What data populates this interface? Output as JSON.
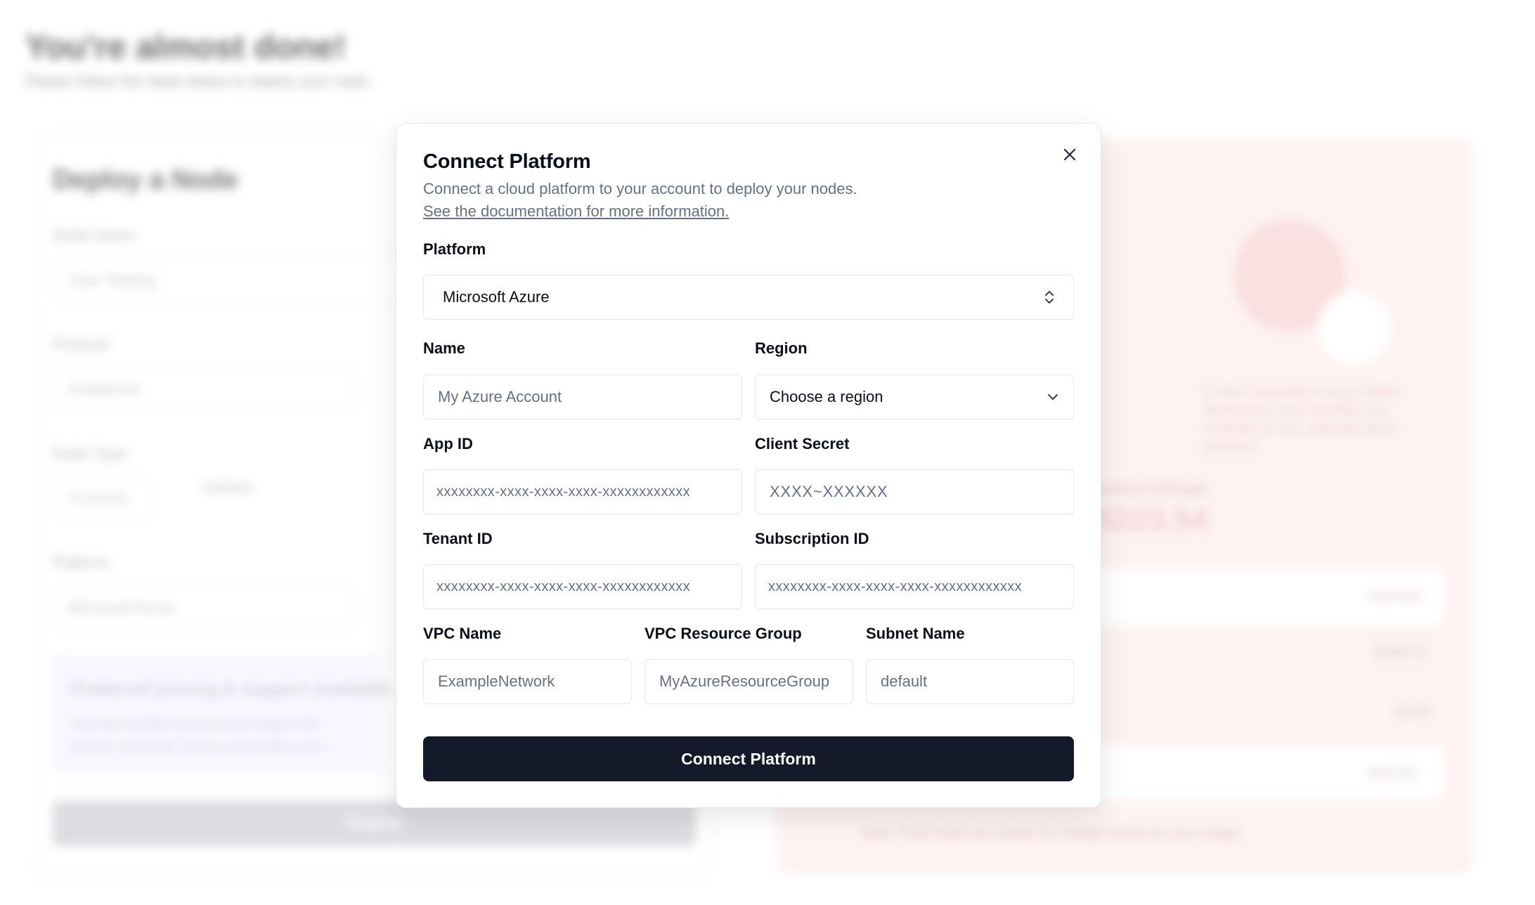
{
  "background": {
    "page_title": "You're almost done!",
    "page_subtitle": "Please follow the steps below to deploy your node.",
    "left_panel": {
      "title": "Deploy a Node",
      "node_name_label": "Node Name",
      "node_name_value": "User Testing",
      "protocol_label": "Protocol",
      "protocol_value": "Avalanche",
      "node_type_label": "Node Type",
      "node_type_tab_1": "Fullnode",
      "node_type_tab_2": "Validator",
      "platform_label": "Platform",
      "platform_value": "Microsoft Azure",
      "info_title": "Preferred pricing & support available",
      "info_text": "You have preferred pricing & support for partner networks. Book a time with us to l",
      "deploy_label": "Deploy"
    },
    "right_panel": {
      "description": "A short summary of your node's deployment and monthly cost estimate for the selected cloud platform.",
      "estimate_label": "Monthly Estimate",
      "estimate_amount": "$223.54",
      "row_1": "Estimate",
      "row_2": "$198.70",
      "row_3": "$0.00",
      "row_4": "$223.54",
      "note": "Note: Final costs are subject to change based on your usage."
    }
  },
  "modal": {
    "title": "Connect Platform",
    "description": "Connect a cloud platform to your account to deploy your nodes.",
    "doc_link": "See the documentation for more information.",
    "platform": {
      "label": "Platform",
      "value": "Microsoft Azure"
    },
    "name": {
      "label": "Name",
      "placeholder": "My Azure Account"
    },
    "region": {
      "label": "Region",
      "value": "Choose a region"
    },
    "app_id": {
      "label": "App ID",
      "placeholder": "xxxxxxxx-xxxx-xxxx-xxxx-xxxxxxxxxxxx"
    },
    "client_secret": {
      "label": "Client Secret",
      "placeholder": "XXXX~XXXXXX"
    },
    "tenant_id": {
      "label": "Tenant ID",
      "placeholder": "xxxxxxxx-xxxx-xxxx-xxxx-xxxxxxxxxxxx"
    },
    "subscription_id": {
      "label": "Subscription ID",
      "placeholder": "xxxxxxxx-xxxx-xxxx-xxxx-xxxxxxxxxxxx"
    },
    "vpc_name": {
      "label": "VPC Name",
      "placeholder": "ExampleNetwork"
    },
    "vpc_resource_group": {
      "label": "VPC Resource Group",
      "placeholder": "MyAzureResourceGroup"
    },
    "subnet_name": {
      "label": "Subnet Name",
      "placeholder": "default"
    },
    "submit_label": "Connect Platform",
    "icons": {
      "close": "close-icon",
      "select": "chevron-up-down-icon",
      "dropdown": "chevron-down-icon"
    }
  }
}
